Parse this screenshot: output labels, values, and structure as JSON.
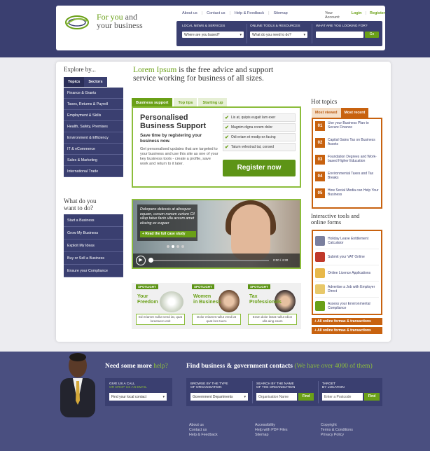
{
  "header": {
    "brand_line1": "For you",
    "brand_and": " and",
    "brand_line2": "your business",
    "links": [
      "About us",
      "Contact us",
      "Help & Feedback",
      "Sitemap"
    ],
    "account_label": "Your Account:",
    "login": "Login",
    "register": "Register",
    "search": {
      "local_news_label": "LOCAL NEWS & SERVICES",
      "local_news_value": "Where are you based?",
      "tools_label": "ONLINE TOOLS & RESOURCES",
      "tools_value": "What do you need to do?",
      "looking_label": "WHAT ARE YOU LOOKING FOR?",
      "go": "Go"
    }
  },
  "sidebar": {
    "explore_heading": "Explore by...",
    "tabs": [
      "Topics",
      "Sectors"
    ],
    "topics": [
      "Finance & Grants",
      "Taxes, Returns & Payroll",
      "Employment & Skills",
      "Health, Safety, Premises",
      "Environment & Efficiency",
      "IT & eCommerce",
      "Sales & Marketing",
      "International Trade"
    ],
    "what_heading_1": "What do you",
    "what_heading_2": "want to do?",
    "actions": [
      "Start a Business",
      "Grow My Business",
      "Exploit My Ideas",
      "Buy or Sell a Business",
      "Ensure your Compliance"
    ]
  },
  "hero": {
    "highlight": "Lorem Ipsum",
    "rest_line1": " is the free advice and support",
    "line2": "service working for business of all sizes."
  },
  "support": {
    "tabs": [
      "Business support",
      "Top tips",
      "Starting up"
    ],
    "title_line1": "Personalised",
    "title_line2": "Business Support",
    "subtitle": "Save time by registering your business now.",
    "text": "Get personalised updates that are targeted to your business and use this site as one of your key business tools - create a profile, save work and return to it later.",
    "checks": [
      "Lis at, quipis eugait lam exer",
      "Magnim digna corem dolor",
      "Odi eriam et modip ex facing",
      "Tatum velestrud tat, consed"
    ],
    "register_button": "Register now"
  },
  "video": {
    "quote": "Dolorpero delessis at alissquor equam, conum nonum zzriure Cil ullup tatue facin ulla accum amet elscing ex euguer",
    "case_study": "+ Read the full case study",
    "time": "0:00 / 4:30"
  },
  "spotlights": [
    {
      "tag": "SPOTLIGHT",
      "title_1": "Your",
      "title_2": "Freedom",
      "text": "Ed eriamet nullut vend iat, quat loreetuero enit"
    },
    {
      "tag": "SPOTLIGHT",
      "title_1": "Women",
      "title_2": "in Business",
      "text": "Dolor eriamet nullut vend iat quat lore tuero"
    },
    {
      "tag": "SPOTLIGHT",
      "title_1": "Tax",
      "title_2": "Professionals",
      "text": "Eram dolor latrat nullut rdion ulla aing esam"
    }
  ],
  "hot_topics": {
    "heading": "Hot topics",
    "tabs": [
      "Most viewed",
      "Most recent"
    ],
    "items": [
      {
        "num": "01",
        "text": "Use your Business Plan to Secure Finance"
      },
      {
        "num": "02",
        "text": "Capital Gains Tax on Business Assets"
      },
      {
        "num": "03",
        "text": "Foundation Degrees and Work-based Higher Education"
      },
      {
        "num": "04",
        "text": "Environmental Taxes and Tax Breaks"
      },
      {
        "num": "05",
        "text": "How Social Media can Help Your Business"
      }
    ]
  },
  "interactive": {
    "heading_1": "Interactive tools and",
    "heading_2": "online forms",
    "items": [
      {
        "text": "Holiday Leave Entitlement Calculator",
        "color": "#7a7f9e"
      },
      {
        "text": "Submit your VAT Online",
        "color": "#c0392b"
      },
      {
        "text": "Online Licence Applications",
        "color": "#e8b84a"
      },
      {
        "text": "Advertise a Job with Employer Direct",
        "color": "#e8c86a"
      },
      {
        "text": "Assess your Environmental Compliance",
        "color": "#6aa017"
      }
    ],
    "buttons": [
      "+ All online formas & transactions",
      "+ All online formas & transactions"
    ]
  },
  "footer": {
    "need_help": "Need some more",
    "need_help_g": " help?",
    "find_contacts": "Find business & government contacts",
    "find_contacts_g": " (We have over 4000 of them)",
    "call_label_1": "GIVE US A CALL",
    "call_label_2": "OR DROP US AN EMAIL",
    "call_value": "Find your local contact",
    "browse_label_1": "BROWSE BY THE TYPE",
    "browse_label_2": "OF ORGANISATION",
    "browse_value": "Government Departments",
    "search_label_1": "SEARCH BY THE NAME",
    "search_label_2": "OF THE ORGANISATION",
    "search_value": "Organisation Name",
    "target_label_1": "TARGET",
    "target_label_2": "BY LOCATION",
    "target_value": "Enter a Postcode",
    "find": "Find",
    "links_col1": [
      "About us",
      "Contact us",
      "Help & Feedback"
    ],
    "links_col2": [
      "Accessibility",
      "Help with PDF Files",
      "Sitemap"
    ],
    "links_col3": [
      "Copyright",
      "Terms & Conditions",
      "Privacy Policy"
    ]
  },
  "colors": {
    "navy": "#3a3f70",
    "green": "#6aa017",
    "orange": "#c8620f"
  }
}
